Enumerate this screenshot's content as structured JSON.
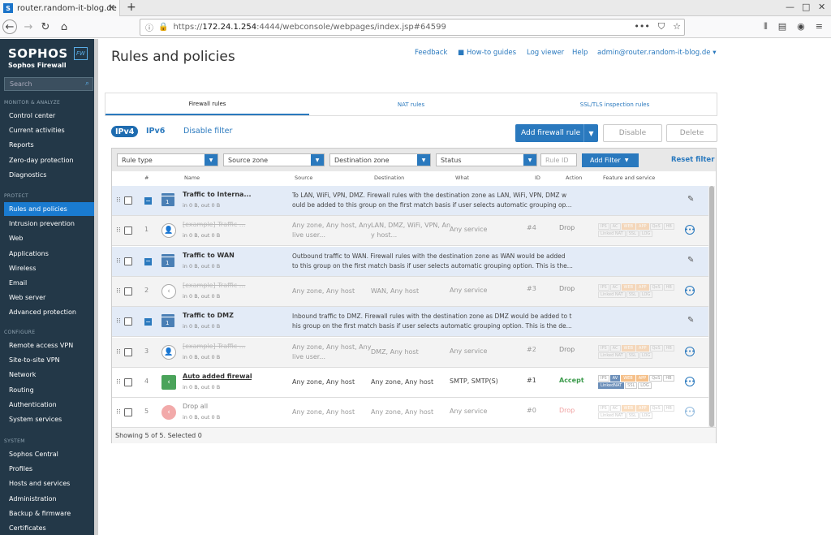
{
  "browser": {
    "tab_title": "router.random-it-blog.de",
    "favicon_letter": "S",
    "url_prefix": "https://",
    "url_host": "172.24.1.254",
    "url_rest": ":4444/webconsole/webpages/index.jsp#64599"
  },
  "sidebar": {
    "brand": "SOPHOS",
    "product": "Sophos Firewall",
    "badge": "FW",
    "search_placeholder": "Search",
    "sections": [
      {
        "title": "MONITOR & ANALYZE",
        "items": [
          "Control center",
          "Current activities",
          "Reports",
          "Zero-day protection",
          "Diagnostics"
        ]
      },
      {
        "title": "PROTECT",
        "items": [
          "Rules and policies",
          "Intrusion prevention",
          "Web",
          "Applications",
          "Wireless",
          "Email",
          "Web server",
          "Advanced protection"
        ]
      },
      {
        "title": "CONFIGURE",
        "items": [
          "Remote access VPN",
          "Site-to-site VPN",
          "Network",
          "Routing",
          "Authentication",
          "System services"
        ]
      },
      {
        "title": "SYSTEM",
        "items": [
          "Sophos Central",
          "Profiles",
          "Hosts and services",
          "Administration",
          "Backup & firmware",
          "Certificates"
        ]
      }
    ],
    "active_item": "Rules and policies"
  },
  "header": {
    "title": "Rules and policies",
    "links": [
      "Feedback",
      "How-to guides",
      "Log viewer",
      "Help",
      "admin@router.random-it-blog.de"
    ]
  },
  "tabs": [
    "Firewall rules",
    "NAT rules",
    "SSL/TLS inspection rules"
  ],
  "ip_toggle": {
    "ipv4": "IPv4",
    "ipv6": "IPv6",
    "disable_filter": "Disable filter"
  },
  "actions": {
    "add_rule": "Add firewall rule",
    "disable": "Disable",
    "delete": "Delete"
  },
  "filters": {
    "rule_type": "Rule type",
    "source_zone": "Source zone",
    "destination_zone": "Destination zone",
    "status": "Status",
    "rule_id_placeholder": "Rule ID",
    "add_filter": "Add Filter",
    "reset_filter": "Reset filter"
  },
  "columns": {
    "num": "#",
    "name": "Name",
    "source": "Source",
    "destination": "Destination",
    "what": "What",
    "id": "ID",
    "action": "Action",
    "feature": "Feature and service"
  },
  "rows": [
    {
      "kind": "group",
      "name": "Traffic to Interna...",
      "sub": "in 0 B, out 0 B",
      "desc1": "To LAN, WiFi, VPN, DMZ. Firewall rules with the destination zone as LAN, WiFi, VPN, DMZ w",
      "desc2": "ould be added to this group on the first match basis if user selects automatic grouping op..."
    },
    {
      "kind": "child",
      "num": "1",
      "name": "[example] Traffic ...",
      "sub": "in 0 B, out 0 B",
      "source1": "Any zone, Any host, Any",
      "source2": "live user...",
      "dest1": "LAN, DMZ, WiFi, VPN, An",
      "dest2": "y host...",
      "what": "Any service",
      "id": "#4",
      "action": "Drop"
    },
    {
      "kind": "group",
      "name": "Traffic to WAN",
      "sub": "in 0 B, out 0 B",
      "desc1": "Outbound traffic to WAN. Firewall rules with the destination zone as WAN would be added",
      "desc2": "to this group on the first match basis if user selects automatic grouping option. This is the..."
    },
    {
      "kind": "child",
      "num": "2",
      "name": "[example] Traffic ...",
      "sub": "in 0 B, out 0 B",
      "source1": "Any zone, Any host",
      "source2": "",
      "dest1": "WAN, Any host",
      "dest2": "",
      "what": "Any service",
      "id": "#3",
      "action": "Drop"
    },
    {
      "kind": "group",
      "name": "Traffic to DMZ",
      "sub": "in 0 B, out 0 B",
      "desc1": "Inbound traffic to DMZ. Firewall rules with the destination zone as DMZ would be added to t",
      "desc2": "his group on the first match basis if user selects automatic grouping option. This is the de..."
    },
    {
      "kind": "child",
      "num": "3",
      "name": "[example] Traffic ...",
      "sub": "in 0 B, out 0 B",
      "source1": "Any zone, Any host, Any",
      "source2": "live user...",
      "dest1": "DMZ, Any host",
      "dest2": "",
      "what": "Any service",
      "id": "#2",
      "action": "Drop"
    },
    {
      "kind": "plain",
      "num": "4",
      "name": "Auto added firewal...",
      "sub": "in 0 B, out 0 B",
      "source1": "Any zone, Any host",
      "source2": "",
      "dest1": "Any zone, Any host",
      "dest2": "",
      "what": "SMTP, SMTP(S)",
      "id": "#1",
      "action": "Accept"
    },
    {
      "kind": "plain",
      "num": "5",
      "name": "Drop all",
      "sub": "in 0 B, out 0 B",
      "source1": "Any zone, Any host",
      "source2": "",
      "dest1": "Any zone, Any host",
      "dest2": "",
      "what": "Any service",
      "id": "#0",
      "action": "Drop"
    }
  ],
  "footer": "Showing 5 of 5. Selected 0",
  "colors": {
    "accent": "#2a79be",
    "sidebar": "#233848",
    "accept": "#3c9b4c",
    "drop": "#888888"
  }
}
